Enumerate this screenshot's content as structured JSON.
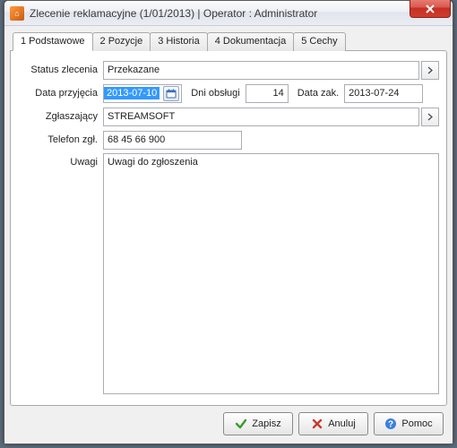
{
  "window": {
    "title": "Zlecenie reklamacyjne (1/01/2013)  |  Operator : Administrator"
  },
  "tabs": [
    {
      "label": "1 Podstawowe",
      "active": true
    },
    {
      "label": "2 Pozycje"
    },
    {
      "label": "3 Historia"
    },
    {
      "label": "4 Dokumentacja"
    },
    {
      "label": "5 Cechy"
    }
  ],
  "labels": {
    "status": "Status zlecenia",
    "date_received": "Data przyjęcia",
    "days": "Dni obsługi",
    "date_end": "Data zak.",
    "reporter": "Zgłaszający",
    "phone": "Telefon zgł.",
    "notes": "Uwagi"
  },
  "values": {
    "status": "Przekazane",
    "date_received": "2013-07-10",
    "days": "14",
    "date_end": "2013-07-24",
    "reporter": "STREAMSOFT",
    "phone": "68 45 66 900",
    "notes": "Uwagi do zgłoszenia"
  },
  "buttons": {
    "save": "Zapisz",
    "cancel": "Anuluj",
    "help": "Pomoc"
  }
}
